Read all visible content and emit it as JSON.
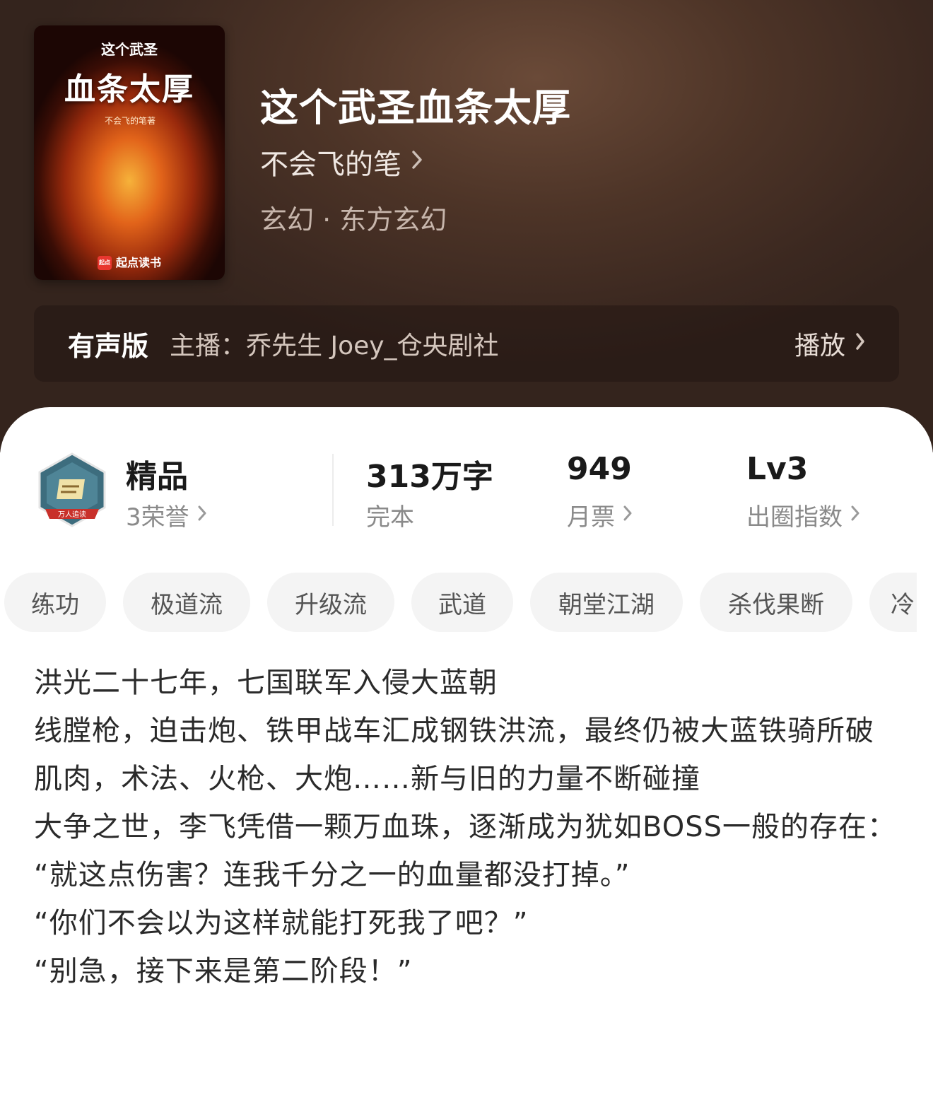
{
  "book": {
    "cover": {
      "title_small": "这个武圣",
      "title_big": "血条太厚",
      "author_line": "不会飞的笔著",
      "publisher": "起点读书",
      "publisher_logo": "起点"
    },
    "title": "这个武圣血条太厚",
    "author": "不会飞的笔",
    "genre": "玄幻 · 东方玄幻"
  },
  "audio": {
    "tag": "有声版",
    "host": "主播：乔先生 Joey_仓央剧社",
    "play_label": "播放"
  },
  "stats": {
    "quality_label": "精品",
    "honors": "3荣誉",
    "badge_text": "万人追读",
    "word_count": "313万字",
    "status": "完本",
    "monthly_tickets": "949",
    "monthly_tickets_label": "月票",
    "level": "Lv3",
    "level_label": "出圈指数"
  },
  "tags": [
    "练功",
    "极道流",
    "升级流",
    "武道",
    "朝堂江湖",
    "杀伐果断",
    "冷"
  ],
  "description": [
    "洪光二十七年，七国联军入侵大蓝朝",
    "线膛枪，迫击炮、铁甲战车汇成钢铁洪流，最终仍被大蓝铁骑所破",
    "肌肉，术法、火枪、大炮……新与旧的力量不断碰撞",
    "大争之世，李飞凭借一颗万血珠，逐渐成为犹如BOSS一般的存在：",
    "“就这点伤害？连我千分之一的血量都没打掉。”",
    "“你们不会以为这样就能打死我了吧？”",
    "“别急，接下来是第二阶段！”"
  ],
  "icons": {
    "chevron": "chevron-right-icon",
    "badge": "honor-badge-icon"
  },
  "colors": {
    "header_bg": "#4d3427",
    "tag_bg": "#f4f4f4",
    "text_primary": "#1a1a1a",
    "text_secondary": "#8a8a8a"
  }
}
